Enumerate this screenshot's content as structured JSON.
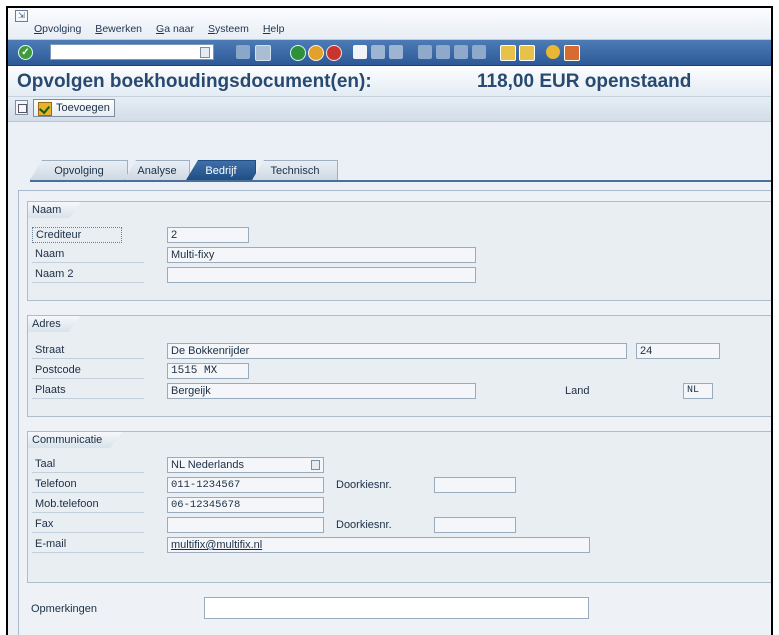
{
  "menubar": {
    "items": [
      "Opvolging",
      "Bewerken",
      "Ga naar",
      "Systeem",
      "Help"
    ]
  },
  "toolbar": {
    "command_field_value": "",
    "icons": [
      "enter-icon",
      "save-icon",
      "back-icon",
      "exit-icon",
      "cancel-icon",
      "print-icon",
      "find-icon",
      "find-next-icon",
      "first-page-icon",
      "prev-page-icon",
      "next-page-icon",
      "last-page-icon",
      "new-session-icon",
      "shortcut-icon",
      "help-icon",
      "layout-icon"
    ]
  },
  "title": {
    "main": "Opvolgen boekhoudingsdocument(en):",
    "amount": "118,00 EUR openstaand"
  },
  "app_toolbar": {
    "add_label": "Toevoegen"
  },
  "tabs": [
    {
      "label": "Opvolging",
      "active": false
    },
    {
      "label": "Analyse",
      "active": false
    },
    {
      "label": "Bedrijf",
      "active": true
    },
    {
      "label": "Technisch",
      "active": false
    }
  ],
  "groups": {
    "naam": {
      "title": "Naam",
      "crediteur_label": "Crediteur",
      "crediteur_value": "2",
      "naam_label": "Naam",
      "naam_value": "Multi-fixy",
      "naam2_label": "Naam 2",
      "naam2_value": ""
    },
    "adres": {
      "title": "Adres",
      "straat_label": "Straat",
      "straat_value": "De Bokkenrijder",
      "huisnummer_value": "24",
      "postcode_label": "Postcode",
      "postcode_value": "1515 MX",
      "plaats_label": "Plaats",
      "plaats_value": "Bergeijk",
      "land_label": "Land",
      "land_value": "NL"
    },
    "communicatie": {
      "title": "Communicatie",
      "taal_label": "Taal",
      "taal_value": "NL Nederlands",
      "telefoon_label": "Telefoon",
      "telefoon_value": "011-1234567",
      "doorkiesnr_label": "Doorkiesnr.",
      "doorkiesnr_value": "",
      "mob_label": "Mob.telefoon",
      "mob_value": "06-12345678",
      "fax_label": "Fax",
      "fax_value": "",
      "fax_doorkiesnr_label": "Doorkiesnr.",
      "fax_doorkiesnr_value": "",
      "email_label": "E-mail",
      "email_value": "multifix@multifix.nl"
    }
  },
  "opmerkingen": {
    "label": "Opmerkingen",
    "value": ""
  }
}
